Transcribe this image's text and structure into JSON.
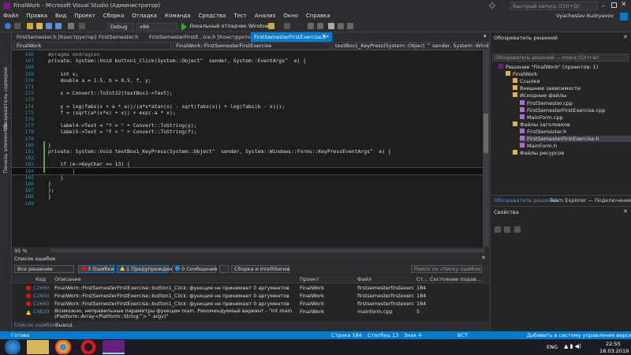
{
  "window": {
    "title": "FinalWork - Microsoft Visual Studio (Администратор)",
    "quick_launch": "Быстрый запуск (Ctrl+Q)",
    "user": "Vyacheslav Kudryavov"
  },
  "menu": [
    "Файл",
    "Правка",
    "Вид",
    "Проект",
    "Сборка",
    "Отладка",
    "Команда",
    "Средства",
    "Тест",
    "Анализ",
    "Окно",
    "Справка"
  ],
  "toolbar": {
    "config": "Debug",
    "platform": "x86",
    "run": "Локальный отладчик Windows"
  },
  "left_strip": [
    "Обозреватель серверов",
    "Панель элементов"
  ],
  "doc_tabs": [
    {
      "label": "FirstSemester.h [Конструктор]",
      "active": false
    },
    {
      "label": "FirstSemester.h",
      "active": false
    },
    {
      "label": "FirstSemesterFirstE...ice.h [Конструктор]*",
      "active": false
    },
    {
      "label": "FirstSemesterFirstExercise.h*",
      "active": true
    }
  ],
  "nav": {
    "project": "FinalWork",
    "scope": "FinalWork::FirstSemesterFirstExercise",
    "member": "textBox1_KeyPress(System::Object ^ sender, System::Windows::Forms"
  },
  "code_lines": [
    {
      "n": "166",
      "t": "#pragma endregion",
      "c": "pp"
    },
    {
      "n": "167",
      "t": "private: System::Void button1_Click(System::Object^  sender, System::EventArgs^  e) {",
      "c": ""
    },
    {
      "n": "168",
      "t": "",
      "c": ""
    },
    {
      "n": "169",
      "t": "    int x;",
      "c": ""
    },
    {
      "n": "170",
      "t": "    double a = 1.5, b = 0.5, f, y;",
      "c": ""
    },
    {
      "n": "171",
      "t": "",
      "c": ""
    },
    {
      "n": "172",
      "t": "    x = Convert::ToInt32(textBox1->Text);",
      "c": ""
    },
    {
      "n": "173",
      "t": "",
      "c": ""
    },
    {
      "n": "174",
      "t": "    y = log(fabs(x + a * a))/(a*x*atan(x) - sqrt(fabs(x)) + log(fabs(b - x)));",
      "c": ""
    },
    {
      "n": "175",
      "t": "    f = (sqrt(a*(x*x) + x)) + exp(-a * x);",
      "c": ""
    },
    {
      "n": "176",
      "t": "",
      "c": ""
    },
    {
      "n": "177",
      "t": "    label4->Text = \"Y = \" + Convert::ToString(y);",
      "c": ""
    },
    {
      "n": "178",
      "t": "    label5->Text = \"F = \" + Convert::ToString(f);",
      "c": ""
    },
    {
      "n": "179",
      "t": "",
      "c": ""
    },
    {
      "n": "180",
      "t": "}",
      "c": ""
    },
    {
      "n": "181",
      "t": "private: System::Void textBox1_KeyPress(System::Object^  sender, System::Windows::Forms::KeyPressEventArgs^  e) {",
      "c": ""
    },
    {
      "n": "182",
      "t": "",
      "c": ""
    },
    {
      "n": "183",
      "t": "    if (e->KeyChar == 13) {",
      "c": ""
    },
    {
      "n": "184",
      "t": "        |",
      "c": ""
    },
    {
      "n": "185",
      "t": "    }",
      "c": ""
    },
    {
      "n": "186",
      "t": "}",
      "c": ""
    },
    {
      "n": "187",
      "t": "};",
      "c": ""
    },
    {
      "n": "188",
      "t": "}",
      "c": ""
    },
    {
      "n": "189",
      "t": "",
      "c": ""
    }
  ],
  "zoom": "95 %",
  "errors": {
    "title": "Список ошибок",
    "scope": "Все решение",
    "errors_chip": "3 Ошибки",
    "warn_chip": "1 Предупреждение",
    "msg_chip": "0 Сообщения",
    "build": "Сборка и IntelliSense",
    "search": "Поиск по списку ошибок",
    "columns": [
      "Код",
      "Описание",
      "Проект",
      "Файл",
      "Ст...",
      "Состояние подав..."
    ],
    "rows": [
      {
        "code": "C2660",
        "desc": "FinalWork::FirstSemesterFirstExercise::button1_Click: функция не принимает 0 аргументов",
        "project": "FinalWork",
        "file": "firstsemesterfirstexercise.h",
        "line": "184",
        "kind": "error"
      },
      {
        "code": "C2660",
        "desc": "FinalWork::FirstSemesterFirstExercise::button1_Click: функция не принимает 0 аргументов",
        "project": "FinalWork",
        "file": "firstsemesterfirstexercise.h",
        "line": "184",
        "kind": "error"
      },
      {
        "code": "C2660",
        "desc": "FinalWork::FirstSemesterFirstExercise::button1_Click: функция не принимает 0 аргументов",
        "project": "FinalWork",
        "file": "firstsemesterfirstexercise.h",
        "line": "184",
        "kind": "error"
      },
      {
        "code": "C4829",
        "desc": "Возможно, неправильные параметры функции main. Рекомендуемый вариант - \"int main (Platform::Array<Platform::String^>^ argv)\"",
        "project": "FinalWork",
        "file": "mainform.cpp",
        "line": "5",
        "kind": "warning"
      }
    ],
    "bottom_tabs": [
      "Список ошибок",
      "Вывод"
    ]
  },
  "solution": {
    "title": "Обозреватель решений",
    "search": "Обозреватель решений — поиск (Ctrl+ж)",
    "items": [
      {
        "label": "Решение \"FinalWork\" (проектов: 1)",
        "indent": 0
      },
      {
        "label": "FinalWork",
        "indent": 1
      },
      {
        "label": "Ссылки",
        "indent": 2
      },
      {
        "label": "Внешние зависимости",
        "indent": 2
      },
      {
        "label": "Исходные файлы",
        "indent": 2
      },
      {
        "label": "FirstSemester.cpp",
        "indent": 3
      },
      {
        "label": "FirstSemesterFirstExercise.cpp",
        "indent": 3
      },
      {
        "label": "MainForm.cpp",
        "indent": 3
      },
      {
        "label": "Файлы заголовков",
        "indent": 2
      },
      {
        "label": "FirstSemester.h",
        "indent": 3
      },
      {
        "label": "FirstSemesterFirstExercise.h",
        "indent": 3,
        "selected": true
      },
      {
        "label": "MainForm.h",
        "indent": 3
      },
      {
        "label": "Файлы ресурсов",
        "indent": 2
      }
    ],
    "tabs": [
      "Обозреватель решений",
      "Team Explorer — Подключение"
    ],
    "props_title": "Свойства"
  },
  "status": {
    "ready": "Готово",
    "line": "Строка 184",
    "col": "Столбец 13",
    "ch": "Знак 4",
    "mode": "ВСТ",
    "vcs": "Добавить в систему управления версиями"
  },
  "taskbar": {
    "lang": "ENG",
    "time": "22:55",
    "date": "18.03.2019"
  },
  "colors": {
    "accent": "#007acc",
    "error": "#e51400",
    "warning": "#ffcc00"
  }
}
